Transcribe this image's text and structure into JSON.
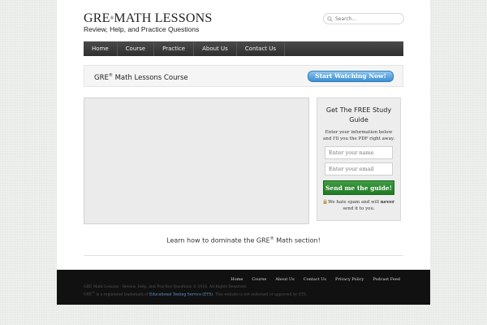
{
  "header": {
    "logo_text": "GRE",
    "logo_sup": "®",
    "logo_rest": "MATH LESSONS",
    "tagline": "Review, Help, and Practice Questions",
    "search_placeholder": "Search..."
  },
  "nav": {
    "items": [
      "Home",
      "Course",
      "Practice",
      "About Us",
      "Contact Us"
    ]
  },
  "promo": {
    "title_prefix": "GRE",
    "title_sup": "®",
    "title_suffix": " Math Lessons Course",
    "button_label": "Start Watching Now!"
  },
  "optin": {
    "title": "Get The FREE Study Guide",
    "description": "Enter your information below and I'll you the PDF right away.",
    "name_placeholder": "Enter your name",
    "email_placeholder": "Enter your email",
    "button_label": "Send me the guide!",
    "note_before": "We hate spam and will ",
    "note_bold": "never",
    "note_after": " send it to you."
  },
  "main": {
    "tagline_prefix": "Learn how to dominate the GRE",
    "tagline_sup": "®",
    "tagline_suffix": " Math section!"
  },
  "footer": {
    "links": [
      "Home",
      "Course",
      "About Us",
      "Contact Us",
      "Privacy Policy",
      "Podcast Feed"
    ],
    "copyright": "GRE Math Lessons - Review, Help, and Practice Questions © 2016. All Rights Reserved.",
    "trademark_prefix": "GRE",
    "trademark_sup": "®",
    "trademark_mid": " is a registered trademark of ",
    "trademark_org": "Educational Testing Service (ETS)",
    "trademark_suffix": ". This website is not endorsed or approved by ETS."
  },
  "colors": {
    "nav_bg": "#3a3a3a",
    "promo_button": "#3b8fd0",
    "optin_button": "#2e8b34",
    "footer_bg": "#111111",
    "link_blue": "#6aa0d8"
  }
}
